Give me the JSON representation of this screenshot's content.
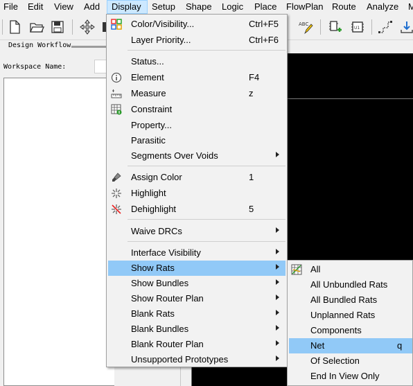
{
  "menubar": {
    "items": [
      "File",
      "Edit",
      "View",
      "Add",
      "Display",
      "Setup",
      "Shape",
      "Logic",
      "Place",
      "FlowPlan",
      "Route",
      "Analyze",
      "M"
    ]
  },
  "toolbar": {
    "icons": [
      "new-file-icon",
      "open-folder-icon",
      "save-icon",
      "move-icon",
      "spellcheck-icon",
      "add-component-icon",
      "chip-icon",
      "route-icon",
      "download-icon"
    ],
    "chip_label": "U1",
    "spell_label": "ABC"
  },
  "workflow": {
    "title": "Design Workflow",
    "workspace_label": "Workspace Name:"
  },
  "display_menu": {
    "items": [
      {
        "label": "Color/Visibility...",
        "shortcut": "Ctrl+F5",
        "icon": "color-visibility-icon"
      },
      {
        "label": "Layer Priority...",
        "shortcut": "Ctrl+F6"
      },
      {
        "label": "Status..."
      },
      {
        "label": "Element",
        "shortcut": "F4",
        "icon": "info-icon"
      },
      {
        "label": "Measure",
        "shortcut": "z",
        "icon": "measure-icon"
      },
      {
        "label": "Constraint",
        "icon": "constraint-icon"
      },
      {
        "label": "Property..."
      },
      {
        "label": "Parasitic"
      },
      {
        "label": "Segments Over Voids",
        "submenu": true
      },
      {
        "label": "Assign Color",
        "shortcut": "1",
        "icon": "paint-brush-icon"
      },
      {
        "label": "Highlight",
        "icon": "highlight-icon"
      },
      {
        "label": "Dehighlight",
        "shortcut": "5",
        "icon": "dehighlight-icon"
      },
      {
        "label": "Waive DRCs",
        "submenu": true
      },
      {
        "label": "Interface Visibility",
        "submenu": true
      },
      {
        "label": "Show Rats",
        "submenu": true,
        "highlighted": true
      },
      {
        "label": "Show Bundles",
        "submenu": true
      },
      {
        "label": "Show Router Plan",
        "submenu": true
      },
      {
        "label": "Blank Rats",
        "submenu": true
      },
      {
        "label": "Blank Bundles",
        "submenu": true
      },
      {
        "label": "Blank Router Plan",
        "submenu": true
      },
      {
        "label": "Unsupported Prototypes",
        "submenu": true
      }
    ]
  },
  "show_rats_submenu": {
    "items": [
      {
        "label": "All",
        "icon": "rats-all-icon"
      },
      {
        "label": "All Unbundled Rats"
      },
      {
        "label": "All Bundled Rats"
      },
      {
        "label": "Unplanned Rats"
      },
      {
        "label": "Components"
      },
      {
        "label": "Net",
        "shortcut": "q",
        "highlighted": true
      },
      {
        "label": "Of Selection"
      },
      {
        "label": "End In View Only"
      }
    ]
  },
  "colors": {
    "menu_highlight": "#91c9f7",
    "menubar_active": "#cce8ff",
    "canvas": "#000000",
    "window_bg": "#f0f0f0"
  }
}
